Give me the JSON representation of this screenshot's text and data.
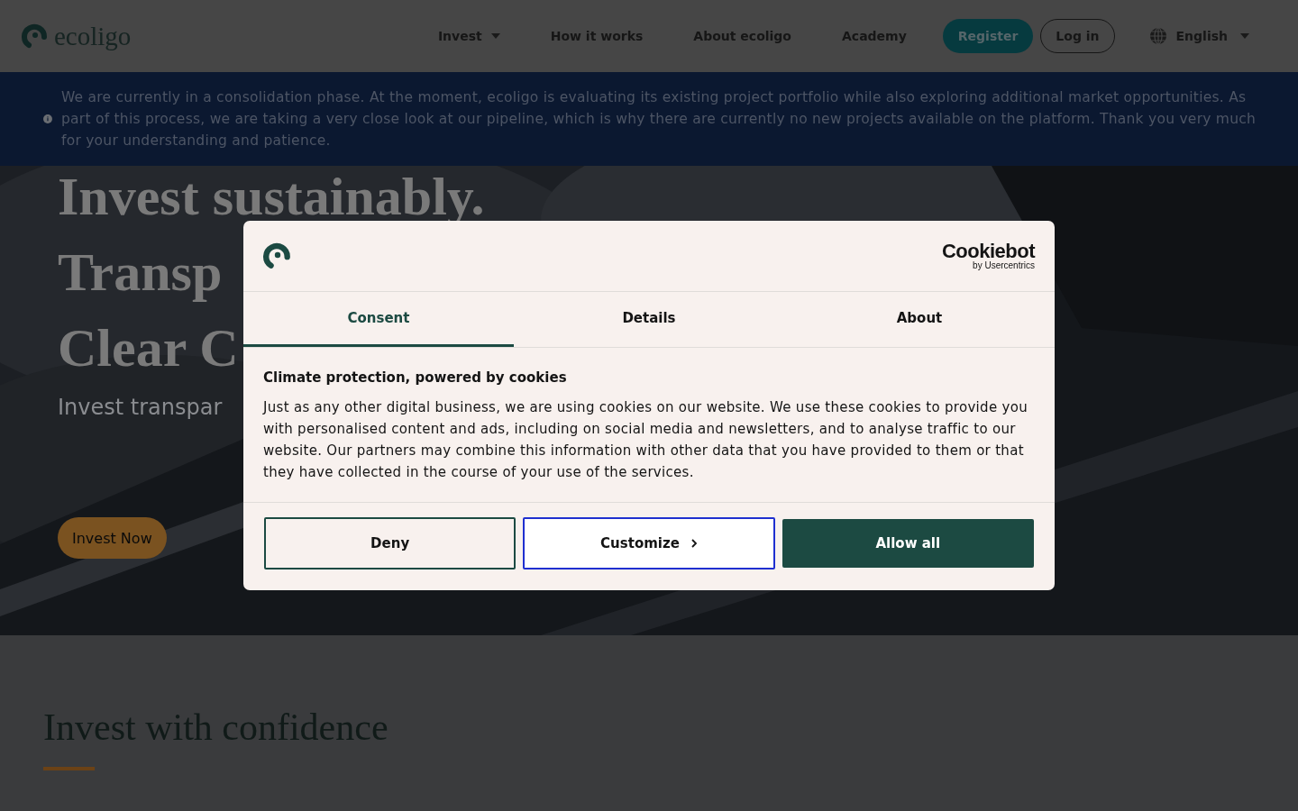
{
  "header": {
    "logo": "ecoligo",
    "nav": [
      {
        "label": "Invest",
        "dropdown": true
      },
      {
        "label": "How it works",
        "dropdown": false
      },
      {
        "label": "About ecoligo",
        "dropdown": false
      },
      {
        "label": "Academy",
        "dropdown": false
      }
    ],
    "register": "Register",
    "login": "Log in",
    "language": "English"
  },
  "notice": "We are currently in a consolidation phase. At the moment, ecoligo is evaluating its existing project portfolio while also exploring additional market opportunities. As part of this process, we are taking a very close look at our pipeline, which is why there are currently no new projects available on the platform. Thank you very much for your understanding and patience.",
  "hero": {
    "headlines": [
      "Invest sustainably.",
      "Transp",
      "Clear C"
    ],
    "subtitle": "Invest transpar",
    "cta": "Invest Now"
  },
  "section": {
    "title": "Invest with confidence"
  },
  "cookie_dialog": {
    "brand": "Cookiebot",
    "brand_sub": "by Usercentrics",
    "tabs": [
      {
        "label": "Consent",
        "selected": true
      },
      {
        "label": "Details",
        "selected": false
      },
      {
        "label": "About",
        "selected": false
      }
    ],
    "heading": "Climate protection, powered by cookies",
    "body": "Just as any other digital business, we are using cookies on our website. We use these cookies to provide you with personalised content and ads, including on social media and newsletters, and to analyse traffic to our website. Our partners may combine this information with other data that you have provided to them or that they have collected in the course of your use of the services.",
    "buttons": [
      {
        "label": "Deny",
        "kind": "outline"
      },
      {
        "label": "Customize",
        "kind": "focused"
      },
      {
        "label": "Allow all",
        "kind": "primary"
      }
    ]
  }
}
